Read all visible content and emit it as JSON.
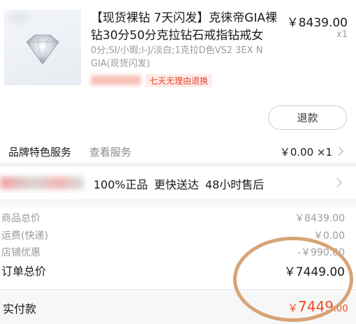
{
  "product": {
    "title": "【现货裸钻 7天闪发】克徕帝GIA裸钻30分50分克拉钻石戒指钻戒女",
    "price": "￥8439.00",
    "quantity": "x1",
    "spec": "0分;SI/小瑕;I-J/淡白;1克拉D色VS2 3EX N GIA(现货闪发)",
    "return_policy_badge": "七天无理由退换",
    "refund_button": "退款"
  },
  "service": {
    "label": "品牌特色服务",
    "link": "查看服务",
    "price": "￥0.00 ×1"
  },
  "guarantee": {
    "text": "100%正品  更快送达  48小时售后"
  },
  "summary": {
    "rows": [
      {
        "label": "商品总价",
        "value": "￥8439.00"
      },
      {
        "label": "运费(快递)",
        "value": "￥0.00"
      },
      {
        "label": "店铺优惠",
        "value": "-￥990.00"
      }
    ],
    "order_total_label": "订单总价",
    "order_total_value": "￥7449.00"
  },
  "payment": {
    "label": "实付款",
    "currency": "￥",
    "integer": "7449",
    "decimals": ".00"
  },
  "colors": {
    "accent": "#f24a1f",
    "badge_text": "#e8442b",
    "annotation_circle": "#d7a476"
  },
  "icons": [
    "diamond-product-image",
    "chevron-right-icon",
    "annotation-circle"
  ]
}
